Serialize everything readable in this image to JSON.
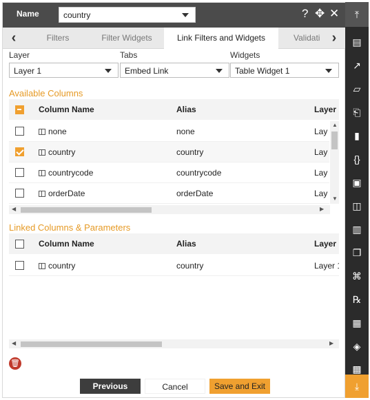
{
  "header": {
    "name_label": "Name",
    "name_value": "country",
    "help_icon": "?",
    "move_icon": "✥",
    "close_icon": "✕"
  },
  "tabs": {
    "items": [
      {
        "label": "Filters"
      },
      {
        "label": "Filter Widgets"
      },
      {
        "label": "Link Filters and Widgets"
      },
      {
        "label": "Validati"
      }
    ],
    "active": "Link Filters and Widgets"
  },
  "fields": {
    "layer_label": "Layer",
    "layer_value": "Layer 1",
    "tabs_label": "Tabs",
    "tabs_value": "Embed Link",
    "widgets_label": "Widgets",
    "widgets_value": "Table Widget 1"
  },
  "available": {
    "title": "Available Columns",
    "headers": {
      "name": "Column Name",
      "alias": "Alias",
      "layer": "Layer"
    },
    "rows": [
      {
        "name": "none",
        "alias": "none",
        "layer": "Lay",
        "checked": false
      },
      {
        "name": "country",
        "alias": "country",
        "layer": "Lay",
        "checked": true
      },
      {
        "name": "countrycode",
        "alias": "countrycode",
        "layer": "Lay",
        "checked": false
      },
      {
        "name": "orderDate",
        "alias": "orderDate",
        "layer": "Lay",
        "checked": false
      }
    ]
  },
  "linked": {
    "title": "Linked Columns & Parameters",
    "headers": {
      "name": "Column Name",
      "alias": "Alias",
      "layer": "Layer"
    },
    "rows": [
      {
        "name": "country",
        "alias": "country",
        "layer": "Layer 1",
        "checked": false
      }
    ]
  },
  "buttons": {
    "previous": "Previous",
    "cancel": "Cancel",
    "save": "Save and Exit"
  },
  "toolbar": {
    "icons": [
      "collapse-up-icon",
      "list-icon",
      "chart-icon",
      "map-icon",
      "report-icon",
      "document-icon",
      "braces-icon",
      "image-icon",
      "widget-icon",
      "bar-chart-icon",
      "copy-icon",
      "hierarchy-icon",
      "formula-icon",
      "sheet-icon",
      "layers-icon",
      "grid-icon",
      "download-icon"
    ]
  },
  "colors": {
    "accent": "#f0a030",
    "header_bg": "#4b4b4b",
    "toolbar_bg": "#2b2b2b"
  }
}
